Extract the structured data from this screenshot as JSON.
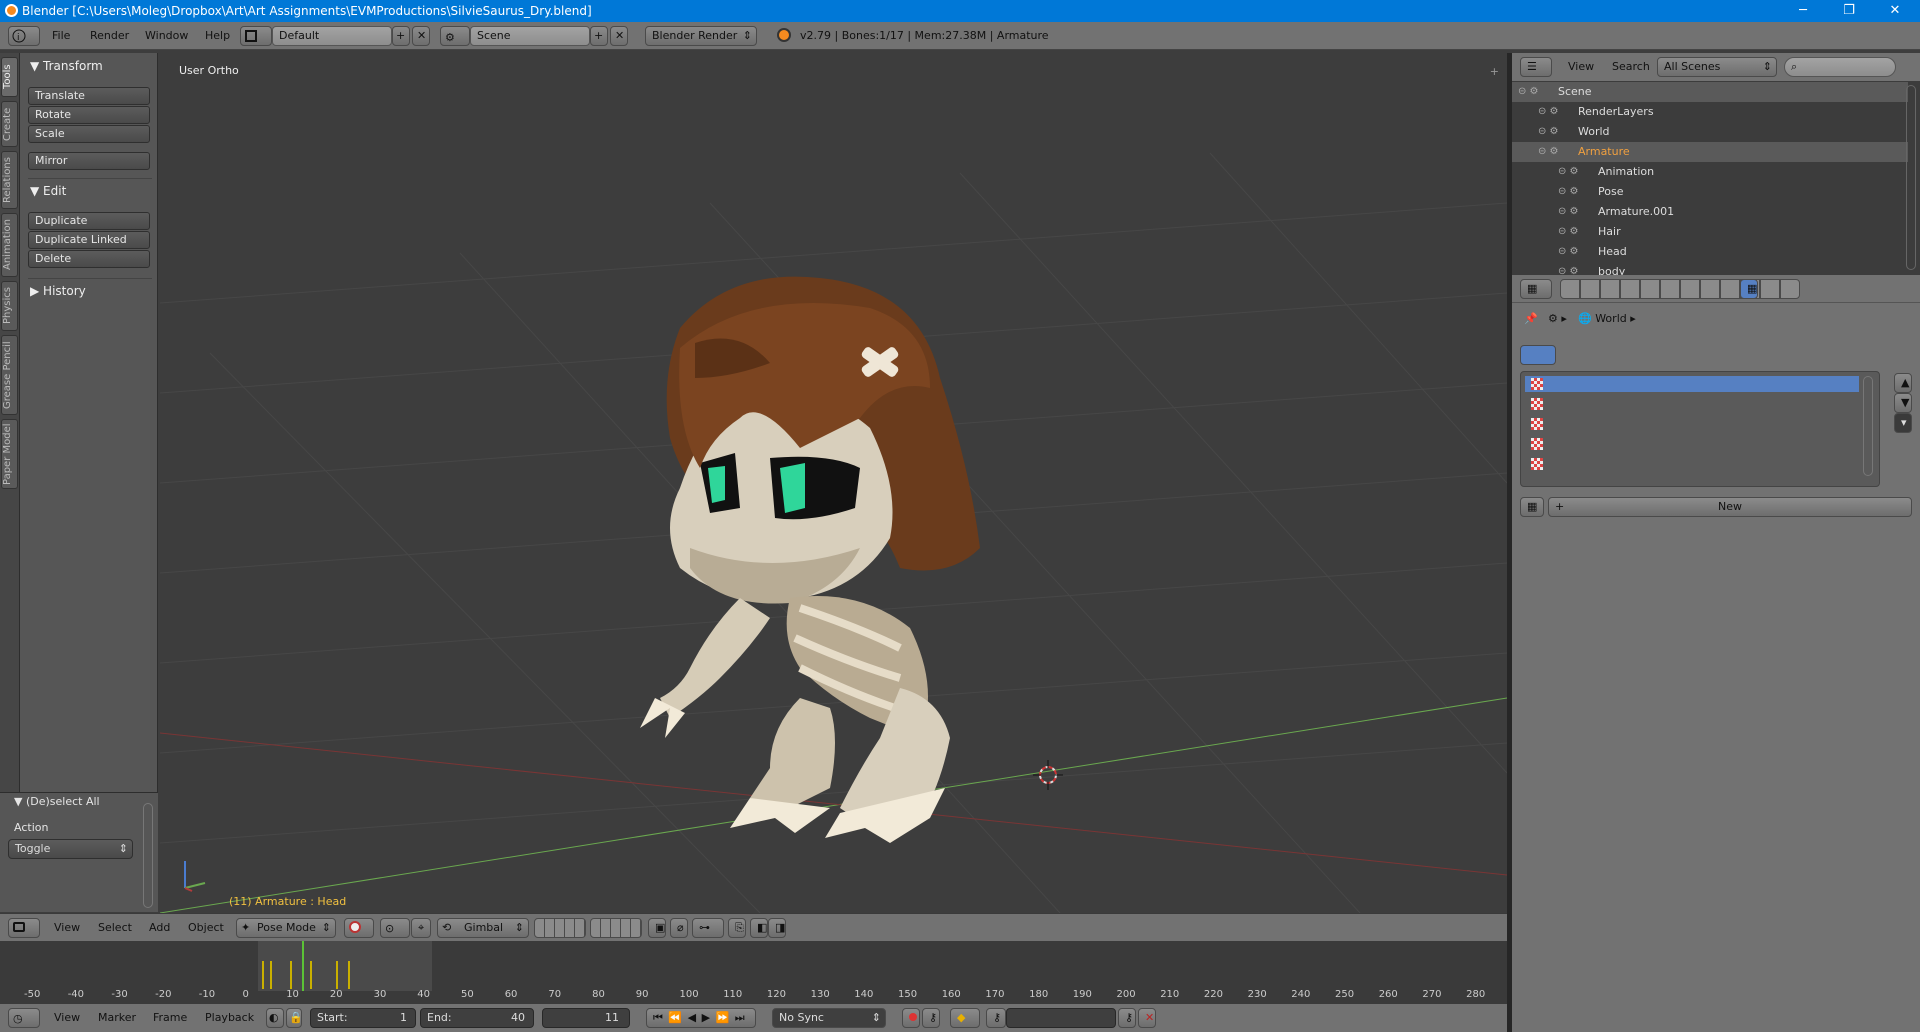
{
  "window": {
    "title": "Blender [C:\\Users\\Moleg\\Dropbox\\Art\\Art Assignments\\EVMProductions\\SilvieSaurus_Dry.blend]",
    "minimize": "─",
    "restore": "❐",
    "close": "✕"
  },
  "top_menu": [
    "File",
    "Render",
    "Window",
    "Help"
  ],
  "layout_name": "Default",
  "scene_name": "Scene",
  "render_engine": "Blender Render",
  "stats": "v2.79 | Bones:1/17 | Mem:27.38M | Armature",
  "viewport": {
    "view_label": "User Ortho",
    "object_label": "(11) Armature : Head",
    "colors": {
      "x_axis": "#b13b3b",
      "y_axis": "#6aa84f",
      "status_text": "#f0c040"
    }
  },
  "tool_tabs": [
    "Tools",
    "Create",
    "Relations",
    "Animation",
    "Physics",
    "Grease Pencil",
    "Paper Model"
  ],
  "tool_shelf": {
    "transform_header": "Transform",
    "transform_buttons": [
      "Translate",
      "Rotate",
      "Scale"
    ],
    "mirror": "Mirror",
    "edit_header": "Edit",
    "edit_buttons": [
      "Duplicate",
      "Duplicate Linked",
      "Delete"
    ],
    "history_header": "History"
  },
  "operator_panel": {
    "title": "(De)select All",
    "action_label": "Action",
    "action_value": "Toggle"
  },
  "view3d_header": {
    "menus": [
      "View",
      "Select",
      "Add",
      "Object"
    ],
    "mode": "Pose Mode",
    "orientation": "Gimbal"
  },
  "timeline": {
    "ticks": [
      "-50",
      "-40",
      "-30",
      "-20",
      "-10",
      "0",
      "10",
      "20",
      "30",
      "40",
      "50",
      "60",
      "70",
      "80",
      "90",
      "100",
      "110",
      "120",
      "130",
      "140",
      "150",
      "160",
      "170",
      "180",
      "190",
      "200",
      "210",
      "220",
      "230",
      "240",
      "250",
      "260",
      "270",
      "280"
    ],
    "current_frame_marker": "11"
  },
  "timeline_header": {
    "menus": [
      "View",
      "Marker",
      "Frame",
      "Playback"
    ],
    "start_label": "Start:",
    "start_value": "1",
    "end_label": "End:",
    "end_value": "40",
    "current_frame": "11",
    "sync": "No Sync"
  },
  "outliner": {
    "menus": [
      "View",
      "Search"
    ],
    "scenes": "All Scenes",
    "rows": [
      {
        "label": "Scene",
        "indent": 0
      },
      {
        "label": "RenderLayers",
        "indent": 1
      },
      {
        "label": "World",
        "indent": 1
      },
      {
        "label": "Armature",
        "indent": 1
      },
      {
        "label": "Animation",
        "indent": 2
      },
      {
        "label": "Pose",
        "indent": 2
      },
      {
        "label": "Armature.001",
        "indent": 2
      },
      {
        "label": "Hair",
        "indent": 2
      },
      {
        "label": "Head",
        "indent": 2
      },
      {
        "label": "body",
        "indent": 2
      }
    ]
  },
  "properties": {
    "breadcrumb": "World",
    "new_button": "New"
  }
}
